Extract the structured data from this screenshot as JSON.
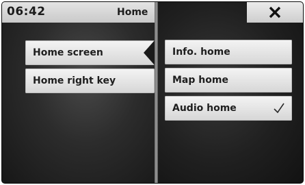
{
  "status_bar": {
    "time": "06:42",
    "title": "Home"
  },
  "close_button": {
    "icon": "close-icon"
  },
  "left_menu": {
    "items": [
      {
        "label": "Home screen",
        "selected": true
      },
      {
        "label": "Home right key",
        "selected": false
      }
    ]
  },
  "right_menu": {
    "items": [
      {
        "label": "Info. home",
        "checked": false
      },
      {
        "label": "Map home",
        "checked": false
      },
      {
        "label": "Audio home",
        "checked": true,
        "icon": "checkmark-icon"
      }
    ]
  }
}
